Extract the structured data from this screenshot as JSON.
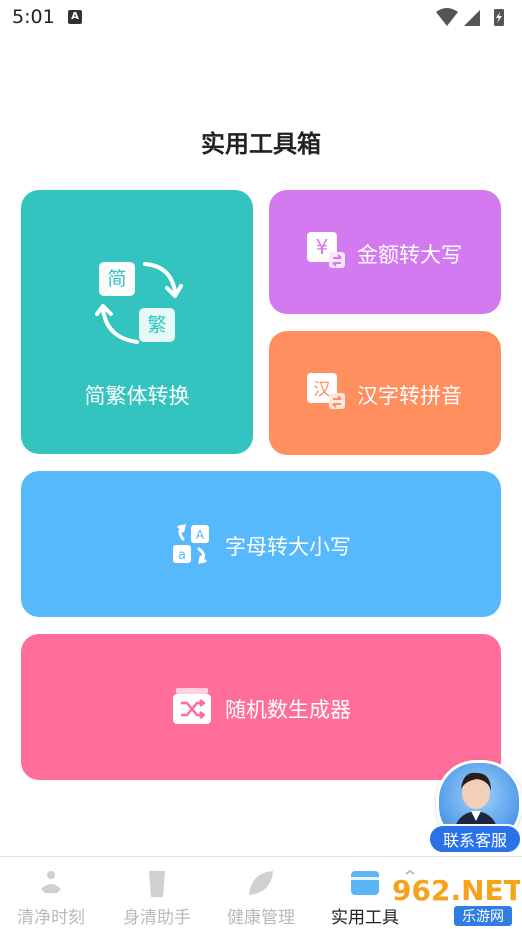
{
  "status": {
    "time": "5:01",
    "a_icon": "A"
  },
  "page": {
    "title": "实用工具箱"
  },
  "cards": {
    "fanjian": {
      "label": "简繁体转换",
      "chip1": "简",
      "chip2": "繁",
      "color": "#34c4c0"
    },
    "jine": {
      "label": "金额转大写",
      "icon": "¥",
      "color": "#d37af0"
    },
    "pinyin": {
      "label": "汉字转拼音",
      "icon": "汉",
      "color": "#ff8f5e"
    },
    "zimu": {
      "label": "字母转大小写",
      "icon_upper": "A",
      "icon_lower": "a",
      "color": "#56b9fc"
    },
    "suiji": {
      "label": "随机数生成器",
      "color": "#ff6e9a"
    }
  },
  "support": {
    "label": "联系客服"
  },
  "nav": {
    "items": [
      {
        "label": "清净时刻",
        "icon": "meditation-icon"
      },
      {
        "label": "身清助手",
        "icon": "cup-icon"
      },
      {
        "label": "健康管理",
        "icon": "leaf-icon"
      },
      {
        "label": "实用工具",
        "icon": "toolbox-icon",
        "active": true
      }
    ]
  },
  "watermark": {
    "text": "962.NET",
    "sub": "乐游网"
  }
}
